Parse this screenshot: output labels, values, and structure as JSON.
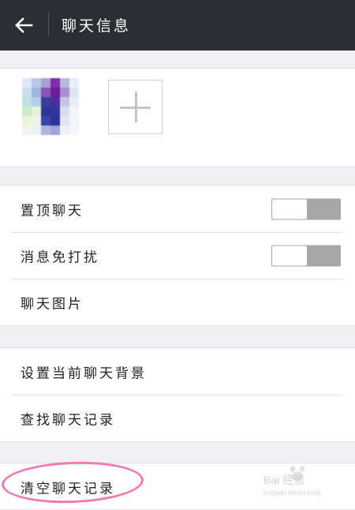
{
  "header": {
    "back_icon": "arrow-left-icon",
    "title": "聊天信息"
  },
  "members": {
    "add_icon": "plus-icon"
  },
  "settings_group1": [
    {
      "label": "置顶聊天",
      "toggle": "off"
    },
    {
      "label": "消息免打扰",
      "toggle": "off"
    },
    {
      "label": "聊天图片"
    }
  ],
  "settings_group2": [
    {
      "label": "设置当前聊天背景"
    },
    {
      "label": "查找聊天记录"
    }
  ],
  "settings_group3": [
    {
      "label": "清空聊天记录"
    }
  ],
  "watermark": {
    "brand": "Bai 经验",
    "url": "jingyan.baidu.com"
  },
  "colors": {
    "header_bg": "#2b2f33",
    "page_bg": "#efeff4",
    "highlight": "#f07ab4",
    "toggle_off": "#a7a7a7"
  }
}
